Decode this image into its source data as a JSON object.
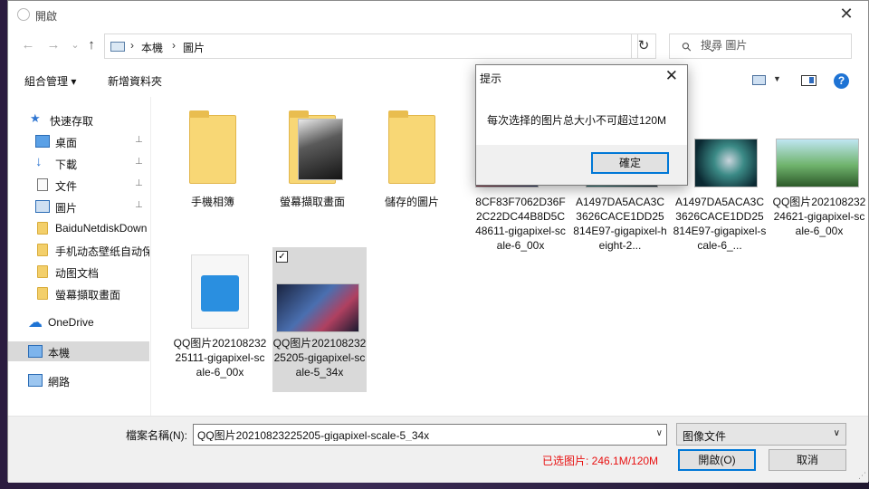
{
  "window": {
    "title": "開啟",
    "close_glyph": "✕"
  },
  "nav": {
    "back_glyph": "←",
    "forward_glyph": "→",
    "recent_glyph": "⌄",
    "up_glyph": "↑",
    "breadcrumb": [
      "本機",
      "圖片"
    ],
    "refresh_glyph": "↻",
    "search_placeholder": "搜尋 圖片"
  },
  "toolbar": {
    "organize_label": "組合管理 ▾",
    "new_folder_label": "新增資料夾"
  },
  "sidebar": {
    "items": [
      {
        "label": "快速存取",
        "icon": "star-icon",
        "pinned": false
      },
      {
        "label": "桌面",
        "icon": "desktop-icon",
        "pinned": true
      },
      {
        "label": "下載",
        "icon": "download-icon",
        "pinned": true
      },
      {
        "label": "文件",
        "icon": "document-icon",
        "pinned": true
      },
      {
        "label": "圖片",
        "icon": "pictures-icon",
        "pinned": true
      },
      {
        "label": "BaiduNetdiskDown",
        "icon": "folder-icon",
        "pinned": false
      },
      {
        "label": "手机动态壁纸自动保",
        "icon": "folder-icon",
        "pinned": false
      },
      {
        "label": "动图文档",
        "icon": "folder-icon",
        "pinned": false
      },
      {
        "label": "螢幕擷取畫面",
        "icon": "folder-icon",
        "pinned": false
      },
      {
        "label": "OneDrive",
        "icon": "cloud-icon",
        "pinned": false
      },
      {
        "label": "本機",
        "icon": "computer-icon",
        "pinned": false
      },
      {
        "label": "網路",
        "icon": "network-icon",
        "pinned": false
      }
    ],
    "pin_glyph": "📌"
  },
  "files": [
    {
      "name": "手機相簿",
      "kind": "folder"
    },
    {
      "name": "螢幕擷取畫面",
      "kind": "folder"
    },
    {
      "name": "儲存的圖片",
      "kind": "folder"
    },
    {
      "name": "8CF83F7062D36F2C22DC44B8D5C48611-gigapixel-scale-6_00x",
      "kind": "image"
    },
    {
      "name": "A1497DA5ACA3C3626CACE1DD25814E97-gigapixel-height-2...",
      "kind": "image"
    },
    {
      "name": "A1497DA5ACA3C3626CACE1DD25814E97-gigapixel-scale-6_...",
      "kind": "image"
    },
    {
      "name": "QQ图片20210823224621-gigapixel-scale-6_00x",
      "kind": "image"
    },
    {
      "name": "QQ图片20210823225111-gigapixel-scale-6_00x",
      "kind": "generic"
    },
    {
      "name": "QQ图片20210823225205-gigapixel-scale-5_34x",
      "kind": "image",
      "selected": true
    }
  ],
  "footer": {
    "filename_label": "檔案名稱(N):",
    "filename_value": "QQ图片20210823225205-gigapixel-scale-5_34x",
    "filetype_value": "图像文件",
    "selected_size_text": "已选图片: 246.1M/120M",
    "open_label": "開啟(O)",
    "cancel_label": "取消"
  },
  "messagebox": {
    "title": "提示",
    "message": "每次选择的图片总大小不可超过120M",
    "ok_label": "確定"
  },
  "colors": {
    "accent": "#0078d7",
    "warning": "#e81010",
    "folder": "#f8d775"
  }
}
